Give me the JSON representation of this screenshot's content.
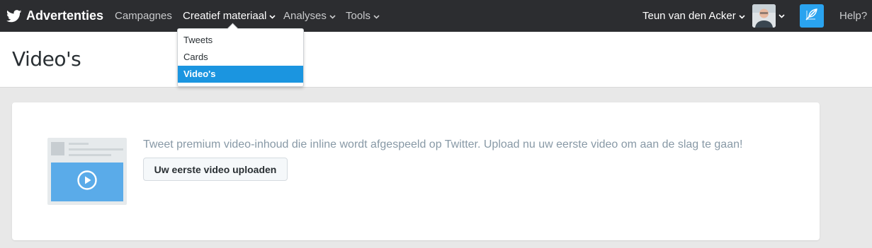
{
  "topbar": {
    "brand_label": "Advertenties",
    "nav": [
      {
        "label": "Campagnes"
      },
      {
        "label": "Creatief materiaal"
      },
      {
        "label": "Analyses"
      },
      {
        "label": "Tools"
      }
    ],
    "user_name": "Teun van den Acker",
    "help_label": "Help?"
  },
  "dropdown": {
    "items": [
      {
        "label": "Tweets"
      },
      {
        "label": "Cards"
      },
      {
        "label": "Video's"
      }
    ],
    "selected_index": 2
  },
  "page": {
    "title": "Video's"
  },
  "card": {
    "promo_text": "Tweet premium video-inhoud die inline wordt afgespeeld op Twitter. Upload nu uw eerste video om aan de slag te gaan!",
    "upload_button_label": "Uw eerste video uploaden"
  },
  "icons": {
    "brand": "twitter-bird-icon",
    "chevron": "chevron-down-icon",
    "compose": "compose-tweet-icon",
    "play": "play-icon"
  },
  "colors": {
    "topbar": "#2c2d30",
    "accent": "#1b95e0",
    "compose_button": "#2aa3ef",
    "video_placeholder": "#5aabe9"
  }
}
